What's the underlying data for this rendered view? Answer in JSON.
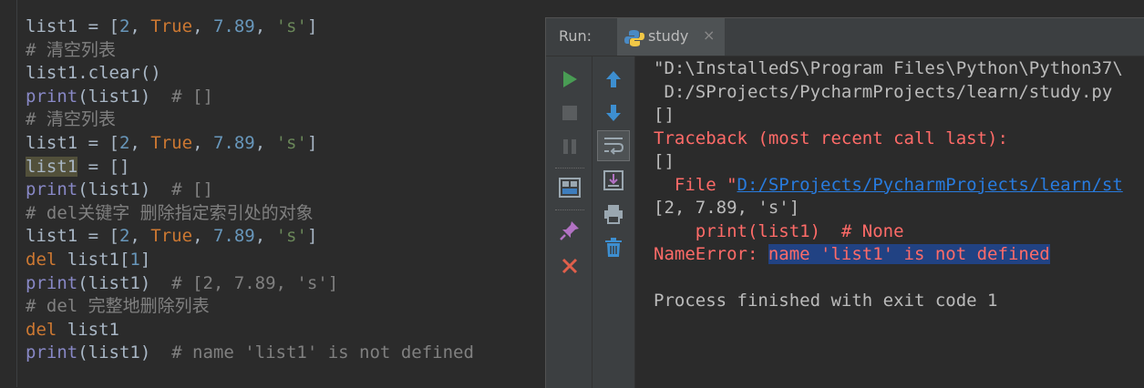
{
  "editor": {
    "lines": [
      [
        {
          "t": "list1 = [",
          "c": "p"
        },
        {
          "t": "2",
          "c": "num"
        },
        {
          "t": ", ",
          "c": "p"
        },
        {
          "t": "True",
          "c": "kw"
        },
        {
          "t": ", ",
          "c": "p"
        },
        {
          "t": "7.89",
          "c": "num"
        },
        {
          "t": ", ",
          "c": "p"
        },
        {
          "t": "'s'",
          "c": "str"
        },
        {
          "t": "]",
          "c": "p"
        }
      ],
      [
        {
          "t": "# 清空列表",
          "c": "cm"
        }
      ],
      [
        {
          "t": "list1.clear()",
          "c": "p"
        }
      ],
      [
        {
          "t": "print",
          "c": "fn"
        },
        {
          "t": "(list1)  ",
          "c": "p"
        },
        {
          "t": "# []",
          "c": "cm"
        }
      ],
      [
        {
          "t": "# 清空列表",
          "c": "cm"
        }
      ],
      [
        {
          "t": "list1 = [",
          "c": "p"
        },
        {
          "t": "2",
          "c": "num"
        },
        {
          "t": ", ",
          "c": "p"
        },
        {
          "t": "True",
          "c": "kw"
        },
        {
          "t": ", ",
          "c": "p"
        },
        {
          "t": "7.89",
          "c": "num"
        },
        {
          "t": ", ",
          "c": "p"
        },
        {
          "t": "'s'",
          "c": "str"
        },
        {
          "t": "]",
          "c": "p"
        }
      ],
      [
        {
          "t": "list1",
          "c": "hl"
        },
        {
          "t": " = []",
          "c": "p"
        }
      ],
      [
        {
          "t": "print",
          "c": "fn"
        },
        {
          "t": "(list1)  ",
          "c": "p"
        },
        {
          "t": "# []",
          "c": "cm"
        }
      ],
      [
        {
          "t": "# del关键字 删除指定索引处的对象",
          "c": "cm"
        }
      ],
      [
        {
          "t": "list1 = [",
          "c": "p"
        },
        {
          "t": "2",
          "c": "num"
        },
        {
          "t": ", ",
          "c": "p"
        },
        {
          "t": "True",
          "c": "kw"
        },
        {
          "t": ", ",
          "c": "p"
        },
        {
          "t": "7.89",
          "c": "num"
        },
        {
          "t": ", ",
          "c": "p"
        },
        {
          "t": "'s'",
          "c": "str"
        },
        {
          "t": "]",
          "c": "p"
        }
      ],
      [
        {
          "t": "del",
          "c": "kw"
        },
        {
          "t": " list1[",
          "c": "p"
        },
        {
          "t": "1",
          "c": "num"
        },
        {
          "t": "]",
          "c": "p"
        }
      ],
      [
        {
          "t": "print",
          "c": "fn"
        },
        {
          "t": "(list1)  ",
          "c": "p"
        },
        {
          "t": "# [2, 7.89, 's']",
          "c": "cm"
        }
      ],
      [
        {
          "t": "# del 完整地删除列表",
          "c": "cm"
        }
      ],
      [
        {
          "t": "del",
          "c": "kw"
        },
        {
          "t": " list1",
          "c": "p"
        }
      ],
      [
        {
          "t": "print",
          "c": "fn"
        },
        {
          "t": "(list1)  ",
          "c": "p"
        },
        {
          "t": "# name 'list1' is not defined",
          "c": "cm"
        }
      ]
    ]
  },
  "run_panel": {
    "label": "Run:",
    "tab_name": "study",
    "tab_close": "×",
    "toolbar_left": [
      "rerun-icon",
      "stop-icon",
      "pause-icon",
      "layout-icon",
      "pin-icon",
      "close-icon"
    ],
    "toolbar_right": [
      "up-arrow-icon",
      "down-arrow-icon",
      "soft-wrap-icon",
      "scroll-to-end-icon",
      "print-icon",
      "trash-icon"
    ],
    "console": [
      [
        {
          "t": "\"D:\\InstalledS\\Program Files\\Python\\Python37\\",
          "c": "p"
        }
      ],
      [
        {
          "t": " D:/SProjects/PycharmProjects/learn/study.py",
          "c": "p"
        }
      ],
      [
        {
          "t": "[]",
          "c": "p"
        }
      ],
      [
        {
          "t": "Traceback (most recent call last):",
          "c": "err"
        }
      ],
      [
        {
          "t": "[]",
          "c": "p"
        }
      ],
      [
        {
          "t": "  File \"",
          "c": "err"
        },
        {
          "t": "D:/SProjects/PycharmProjects/learn/st",
          "c": "link"
        }
      ],
      [
        {
          "t": "[2, 7.89, 's']",
          "c": "p"
        }
      ],
      [
        {
          "t": "    print(list1)  # None",
          "c": "err"
        }
      ],
      [
        {
          "t": "NameError: ",
          "c": "err"
        },
        {
          "t": "name 'list1' is not defined",
          "c": "sel"
        }
      ],
      [
        {
          "t": "",
          "c": "p"
        }
      ],
      [
        {
          "t": "Process finished with exit code 1",
          "c": "p"
        }
      ]
    ]
  },
  "colors": {
    "keyword": "#cc7832",
    "number": "#6897bb",
    "string": "#6a8759",
    "comment": "#808080",
    "builtin": "#8888c6",
    "error": "#ff6b68",
    "link": "#287bde"
  }
}
